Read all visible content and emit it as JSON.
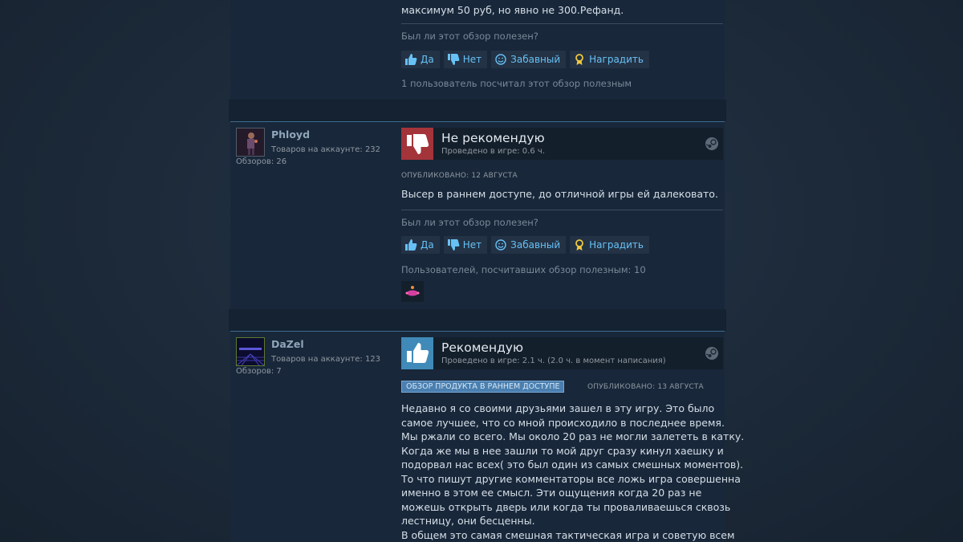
{
  "reviews": [
    {
      "body_lines": [
        "максимум 50 руб, но явно не 300.Рефанд."
      ],
      "helpful_question": "Был ли этот обзор полезен?",
      "buttons": {
        "yes": "Да",
        "no": "Нет",
        "funny": "Забавный",
        "award": "Наградить"
      },
      "helpful_count": "1 пользователь посчитал этот обзор полезным"
    },
    {
      "author": {
        "name": "Phloyd",
        "games": "Товаров на аккаунте: 232",
        "reviews": "Обзоров: 26"
      },
      "verdict": "Не рекомендую",
      "hours": "Проведено в игре: 0.6 ч.",
      "posted": "ОПУБЛИКОВАНО: 12 АВГУСТА",
      "body_lines": [
        "Высер в раннем доступе, до отличной игры ей далековато."
      ],
      "helpful_question": "Был ли этот обзор полезен?",
      "buttons": {
        "yes": "Да",
        "no": "Нет",
        "funny": "Забавный",
        "award": "Наградить"
      },
      "helpful_count": "Пользователей, посчитавших обзор полезным: 10"
    },
    {
      "author": {
        "name": "DaZel",
        "games": "Товаров на аккаунте: 123",
        "reviews": "Обзоров: 7"
      },
      "verdict": "Рекомендую",
      "hours": "Проведено в игре: 2.1 ч. (2.0 ч. в момент написания)",
      "early_access_badge": "ОБЗОР ПРОДУКТА В РАННЕМ ДОСТУПЕ",
      "posted": "ОПУБЛИКОВАНО: 13 АВГУСТА",
      "body_lines": [
        "Недавно я со своими друзьями зашел в эту игру. Это было",
        "самое лучшее, что со мной происходило в последнее время.",
        "Мы ржали со всего. Мы около 20 раз не могли залететь в катку.",
        "Когда же мы в нее зашли то мой друг сразу кинул хаешку и",
        "подорвал нас всех( это был один из самых смешных моментов).",
        "То что пишут другие комментаторы все ложь игра совершенна",
        "именно в этом ее смысл. Эти ощущения когда 20 раз не",
        "можешь открыть дверь или когда ты проваливаешься сквозь",
        "лестницу, они бесценны.",
        "В общем это самая смешная тактическая игра и советую всем"
      ]
    }
  ],
  "colors": {
    "link_blue": "#67c1f5",
    "thumb_down_red": "#a3343a",
    "thumb_up_blue": "#3f8ab8",
    "panel_bg": "#18273a"
  },
  "icons": [
    "thumbs-up-icon",
    "thumbs-down-icon",
    "smiley-icon",
    "award-icon",
    "steam-icon"
  ]
}
